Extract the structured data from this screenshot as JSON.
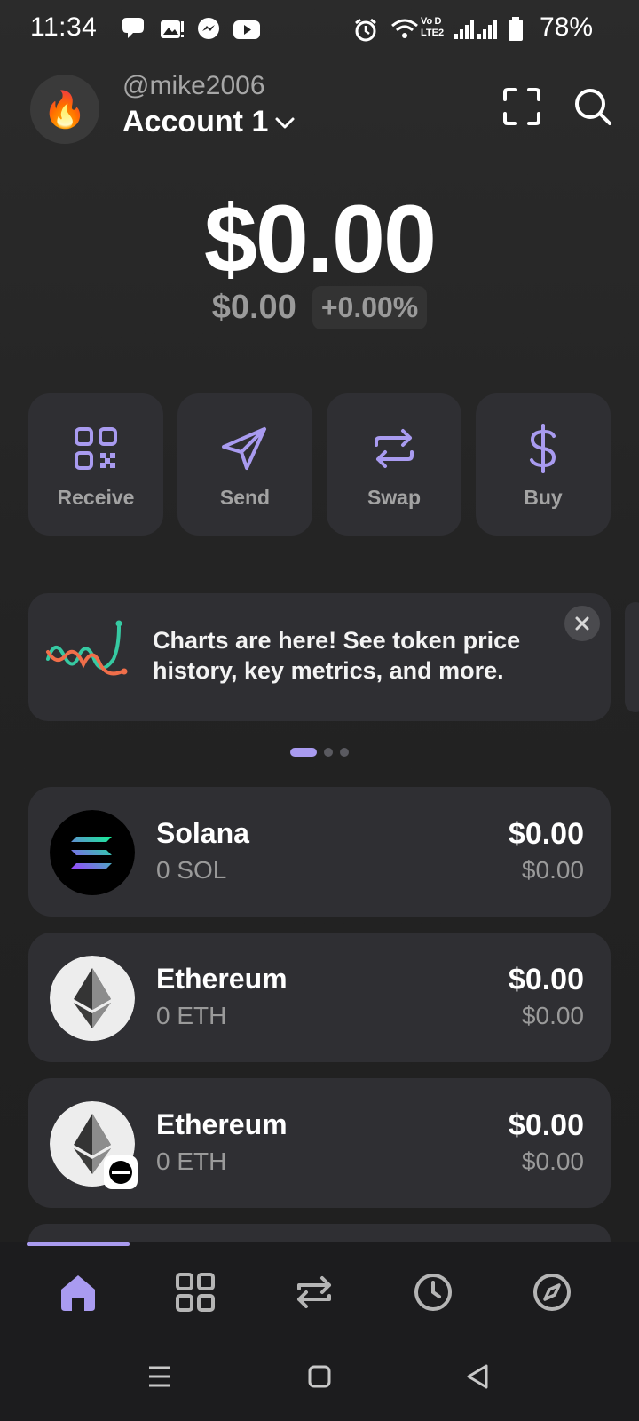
{
  "status": {
    "time": "11:34",
    "battery": "78%"
  },
  "header": {
    "avatar_emoji": "🔥",
    "username": "@mike2006",
    "account": "Account 1"
  },
  "balance": {
    "total": "$0.00",
    "sub": "$0.00",
    "change": "+0.00%"
  },
  "actions": [
    {
      "label": "Receive",
      "icon": "qr-code-icon"
    },
    {
      "label": "Send",
      "icon": "paper-plane-icon"
    },
    {
      "label": "Swap",
      "icon": "swap-arrows-icon"
    },
    {
      "label": "Buy",
      "icon": "dollar-icon"
    }
  ],
  "banner": {
    "text": "Charts are here! See token price history, key metrics, and more.",
    "page": 1,
    "pages": 3
  },
  "tokens": [
    {
      "name": "Solana",
      "amount": "0 SOL",
      "value": "$0.00",
      "change": "$0.00"
    },
    {
      "name": "Ethereum",
      "amount": "0 ETH",
      "value": "$0.00",
      "change": "$0.00"
    },
    {
      "name": "Ethereum",
      "amount": "0 ETH",
      "value": "$0.00",
      "change": "$0.00"
    }
  ],
  "colors": {
    "accent": "#a99bf0",
    "card": "#2f2f33",
    "background": "#232323"
  }
}
